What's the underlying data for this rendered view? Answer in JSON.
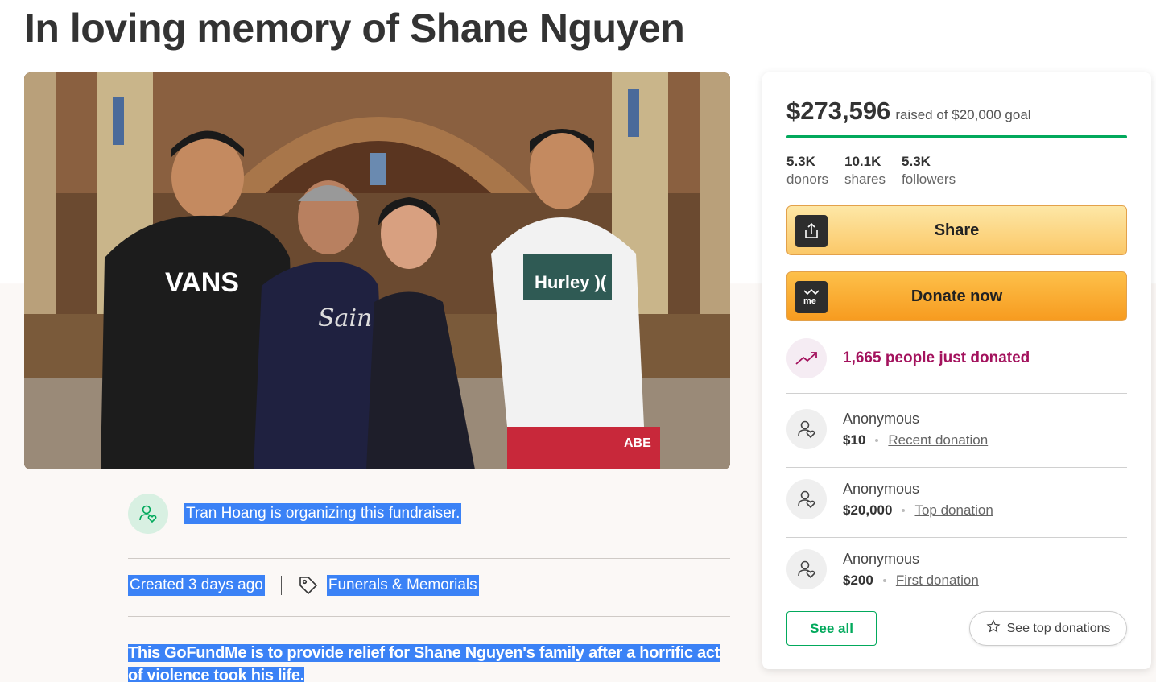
{
  "page": {
    "title": "In loving memory of Shane Nguyen"
  },
  "photo": {
    "shirt_1_text": "VANS",
    "shirt_2_text": "Saint",
    "shirt_4_text": "Hurley )(",
    "shorts_text": "ABE"
  },
  "organizer": {
    "icon": "user-heart-icon",
    "text": "Tran Hoang is organizing this fundraiser."
  },
  "meta": {
    "created": "Created 3 days ago",
    "tag_icon": "tag-icon",
    "category": "Funerals & Memorials"
  },
  "story": {
    "text": "This GoFundMe is to provide relief for Shane Nguyen's family after a horrific act of violence took his life."
  },
  "campaign": {
    "raised": "$273,596",
    "goal_text": "raised of $20,000 goal",
    "progress": 1.0,
    "stats": [
      {
        "value": "5.3K",
        "label": "donors"
      },
      {
        "value": "10.1K",
        "label": "shares"
      },
      {
        "value": "5.3K",
        "label": "followers"
      }
    ],
    "share_label": "Share",
    "share_icon": "share-upload-icon",
    "donate_label": "Donate now",
    "donate_icon": "gofundme-logo-icon",
    "trend_icon": "trending-up-icon",
    "trend_text": "1,665 people just donated"
  },
  "donations": [
    {
      "name": "Anonymous",
      "amount": "$10",
      "kind": "Recent donation"
    },
    {
      "name": "Anonymous",
      "amount": "$20,000",
      "kind": "Top donation"
    },
    {
      "name": "Anonymous",
      "amount": "$200",
      "kind": "First donation"
    }
  ],
  "buttons": {
    "see_all": "See all",
    "see_top": "See top donations",
    "see_top_icon": "star-icon"
  },
  "colors": {
    "brand_green": "#02a95c",
    "donate_orange": "#f79b1f",
    "share_yellow": "#fbc868",
    "trend_magenta": "#a3125d",
    "selection_blue": "#3b82f6"
  }
}
